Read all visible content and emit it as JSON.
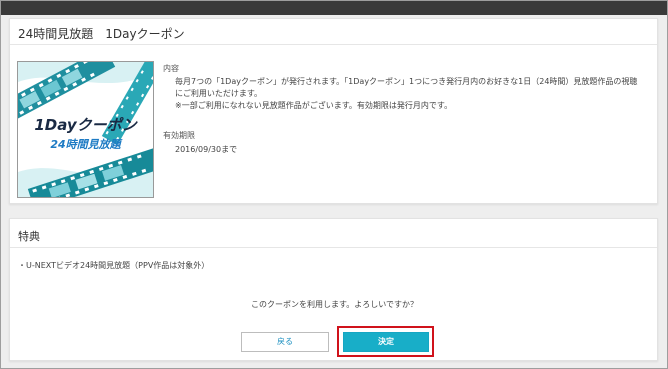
{
  "topbar": {},
  "coupon": {
    "title": "24時間見放題　1Dayクーポン",
    "image_text_main": "1Dayクーポン",
    "image_text_sub": "24時間見放題",
    "content_label": "内容",
    "content_lines": [
      "毎月7つの「1Dayクーポン」が発行されます。「1Dayクーポン」1つにつき発行月内のお好きな1日（24時間）見放題作品の視聴",
      "にご利用いただけます。",
      "※一部ご利用になれない見放題作品がございます。有効期限は発行月内です。"
    ],
    "expiry_label": "有効期限",
    "expiry_value": "2016/09/30まで"
  },
  "benefits": {
    "title": "特典",
    "items": [
      "・U-NEXTビデオ24時間見放題（PPV作品は対象外）"
    ],
    "confirm_question": "このクーポンを利用します。よろしいですか？",
    "back_label": "戻る",
    "confirm_label": "決定"
  },
  "colors": {
    "topbar": "#3a3a3a",
    "confirm_button": "#18aec8",
    "highlight_border": "#d0121b",
    "back_button_text": "#1a8fc0"
  }
}
